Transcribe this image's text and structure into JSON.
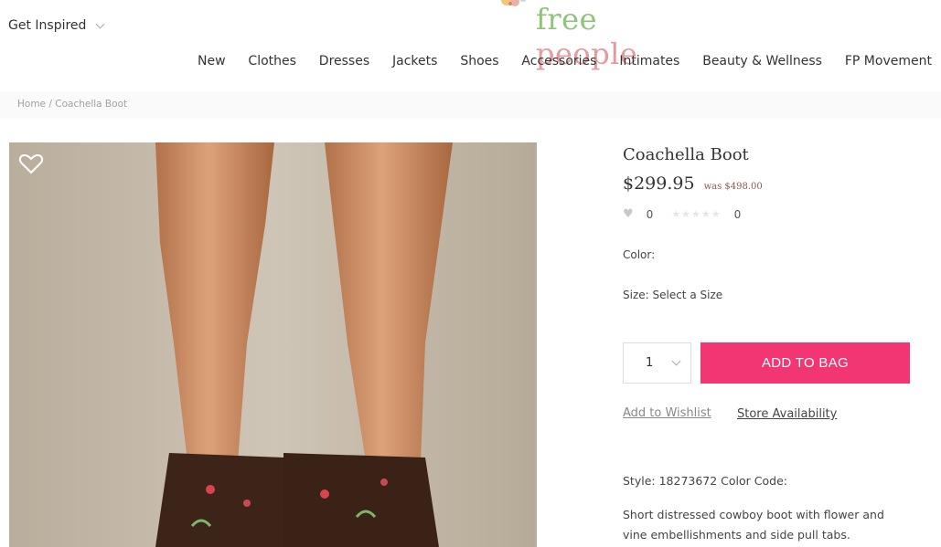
{
  "header": {
    "get_inspired_label": "Get Inspired",
    "logo_free": "free",
    "logo_people": "people"
  },
  "nav": {
    "items": [
      "New",
      "Clothes",
      "Dresses",
      "Jackets",
      "Shoes",
      "Accessories",
      "Intimates",
      "Beauty & Wellness",
      "FP Movement"
    ]
  },
  "breadcrumb": {
    "home": "Home",
    "separator": "/",
    "current": "Coachella Boot"
  },
  "product": {
    "title": "Coachella Boot",
    "price": "$299.95",
    "was_price": "was $498.00",
    "likes_count": "0",
    "reviews_count": "0",
    "color_label": "Color:",
    "size_label": "Size: Select a Size",
    "quantity": "1",
    "add_to_bag_label": "ADD TO BAG",
    "wishlist_link": "Add to Wishlist",
    "store_link": "Store Availability",
    "style_line": "Style: 18273672 Color Code:",
    "description": "Short distressed cowboy boot with flower and vine embellishments and side pull tabs."
  },
  "colors": {
    "accent": "#f23674",
    "logo_green": "#8fc27a",
    "logo_pink": "#e49a9e"
  },
  "icons": {
    "favorite": "heart-outline-icon",
    "chevron": "chevron-down-icon",
    "like": "heart-icon",
    "rating": "star-icon"
  }
}
